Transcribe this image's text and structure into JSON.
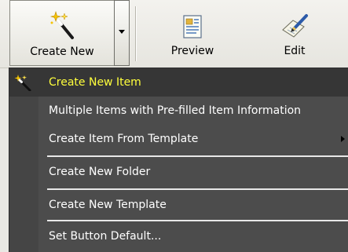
{
  "toolbar": {
    "create_new_label": "Create New",
    "preview_label": "Preview",
    "edit_label": "Edit"
  },
  "menu": {
    "items": [
      {
        "label": "Create New Item",
        "icon": "magic-wand-icon",
        "highlighted": true
      },
      {
        "label": "Multiple Items with Pre-filled Item Information"
      },
      {
        "label": "Create Item From Template",
        "has_submenu": true
      },
      {
        "label": "Create New Folder"
      },
      {
        "label": "Create New Template"
      },
      {
        "label": "Set Button Default..."
      }
    ]
  },
  "colors": {
    "menu_bg": "#4c4c4c",
    "highlight_bg": "#363636",
    "highlight_text": "#ffff3c",
    "menu_text": "#ffffff"
  }
}
